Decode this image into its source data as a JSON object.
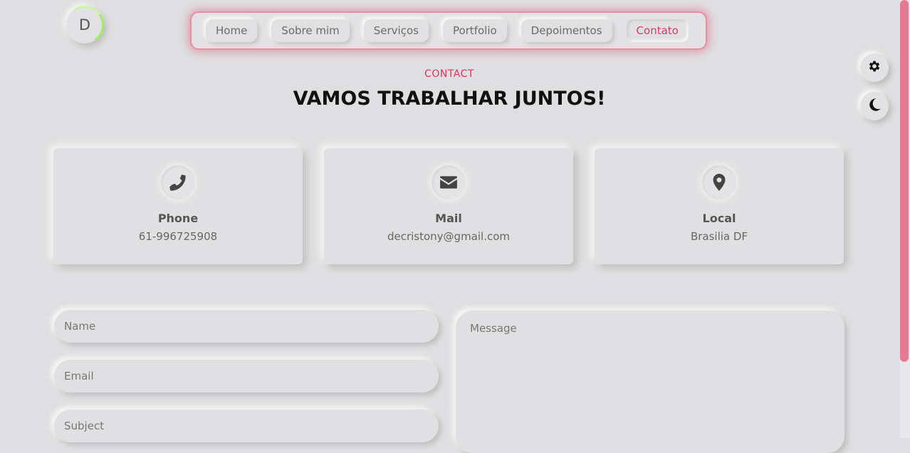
{
  "logo": {
    "letter": "D"
  },
  "nav": {
    "items": [
      {
        "label": "Home"
      },
      {
        "label": "Sobre mim"
      },
      {
        "label": "Serviços"
      },
      {
        "label": "Portfolio"
      },
      {
        "label": "Depoimentos"
      },
      {
        "label": "Contato"
      }
    ],
    "active": "Contato"
  },
  "side_buttons": {
    "settings_icon": "gear-icon",
    "theme_icon": "moon-icon"
  },
  "section": {
    "eyebrow": "CONTACT",
    "title": "VAMOS TRABALHAR JUNTOS!"
  },
  "cards": [
    {
      "icon": "phone-icon",
      "label": "Phone",
      "value": "61-996725908"
    },
    {
      "icon": "envelope-icon",
      "label": "Mail",
      "value": "decristony@gmail.com"
    },
    {
      "icon": "map-pin-icon",
      "label": "Local",
      "value": "Brasilia DF"
    }
  ],
  "form": {
    "name_placeholder": "Name",
    "email_placeholder": "Email",
    "subject_placeholder": "Subject",
    "message_placeholder": "Message"
  },
  "colors": {
    "accent": "#e0365f",
    "background": "#dfdfe1",
    "logo_ring": "#9df05e"
  }
}
